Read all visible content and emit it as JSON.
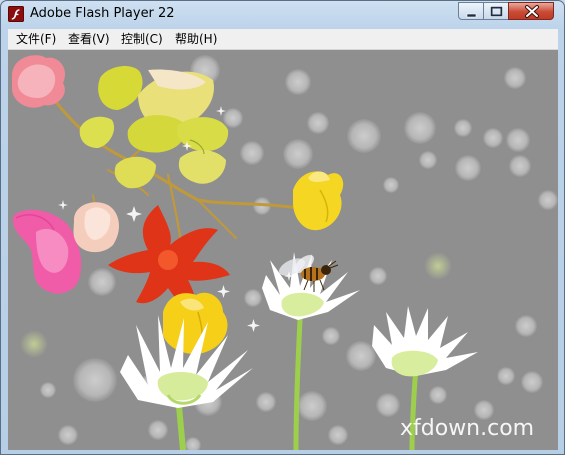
{
  "window": {
    "title": "Adobe Flash Player 22",
    "icon": "flash-player-icon",
    "controls": [
      "minimize-icon",
      "maximize-icon",
      "close-icon"
    ]
  },
  "menu": {
    "items": [
      "文件(F)",
      "查看(V)",
      "控制(C)",
      "帮助(H)"
    ]
  },
  "content": {
    "background_color": "#8f8f8f",
    "watermark": "xfdown.com"
  }
}
